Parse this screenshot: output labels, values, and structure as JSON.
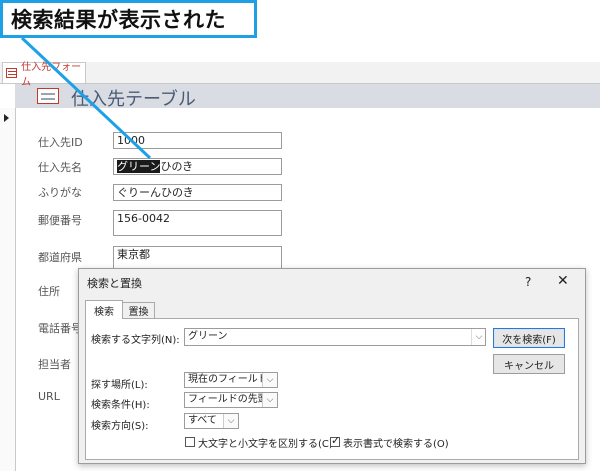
{
  "callout": {
    "text": "検索結果が表示された",
    "color": "#1ea0e6"
  },
  "tabs": {
    "form_tab": "仕入先フォーム"
  },
  "form": {
    "title": "仕入先テーブル",
    "fields": [
      {
        "label": "仕入先ID",
        "value": "1000"
      },
      {
        "label": "仕入先名",
        "value_selected": "グリーン",
        "value_rest": "ひのき"
      },
      {
        "label": "ふりがな",
        "value": "ぐりーんひのき"
      },
      {
        "label": "郵便番号",
        "value": "156-0042"
      },
      {
        "label": "都道府県",
        "value": "東京都"
      },
      {
        "label": "住所"
      },
      {
        "label": "電話番号"
      },
      {
        "label": "担当者"
      },
      {
        "label": "URL"
      }
    ]
  },
  "dialog": {
    "title": "検索と置換",
    "help": "?",
    "close": "✕",
    "tabs": [
      "検索",
      "置換"
    ],
    "find_label": "検索する文字列(N):",
    "find_value": "グリーン",
    "find_next": "次を検索(F)",
    "cancel": "キャンセル",
    "look_in_label": "探す場所(L):",
    "look_in_value": "現在のフィールド",
    "match_label": "検索条件(H):",
    "match_value": "フィールドの先頭",
    "search_label": "検索方向(S):",
    "search_value": "すべて",
    "match_case_label": "大文字と小文字を区別する(C)",
    "match_case_checked": false,
    "format_label": "表示書式で検索する(O)",
    "format_checked": true
  }
}
